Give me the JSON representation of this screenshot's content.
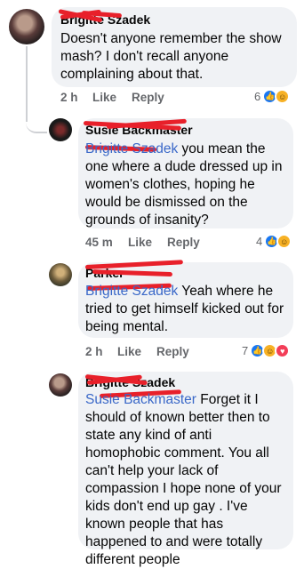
{
  "comments": [
    {
      "name": "Brigitte Szadek",
      "text": "Doesn't anyone remember the show mash? I don't recall anyone complaining about that.",
      "time": "2 h",
      "like_label": "Like",
      "reply_label": "Reply",
      "reaction_count": "6"
    },
    {
      "name": "Susie Backmaster",
      "mention": "Brigitte Szadek",
      "text": " you mean the one where a dude dressed up in women's clothes, hoping he would be dismissed on the grounds of insanity?",
      "time": "45 m",
      "like_label": "Like",
      "reply_label": "Reply",
      "reaction_count": "4"
    },
    {
      "name": "Parker",
      "mention": "Brigitte Szadek",
      "text": " Yeah where he tried to get himself kicked out for being mental.",
      "time": "2 h",
      "like_label": "Like",
      "reply_label": "Reply",
      "reaction_count": "7"
    },
    {
      "name": "Brigitte Szadek",
      "mention": "Susie Backmaster",
      "text": " Forget it I should of known better then to state any kind of anti homophobic comment.  You all can't help your lack of compassion I hope none of your kids don't end up gay . I've known people that has happened to and were totally different people"
    }
  ],
  "colors": {
    "bubble": "#f0f2f5",
    "mention": "#3a68c8",
    "meta": "#65676b",
    "redaction": "#e8202a",
    "like": "#1877f2",
    "haha": "#f7b125",
    "love": "#f33e58"
  },
  "icons": [
    "like-reaction-icon",
    "haha-reaction-icon",
    "love-reaction-icon"
  ]
}
